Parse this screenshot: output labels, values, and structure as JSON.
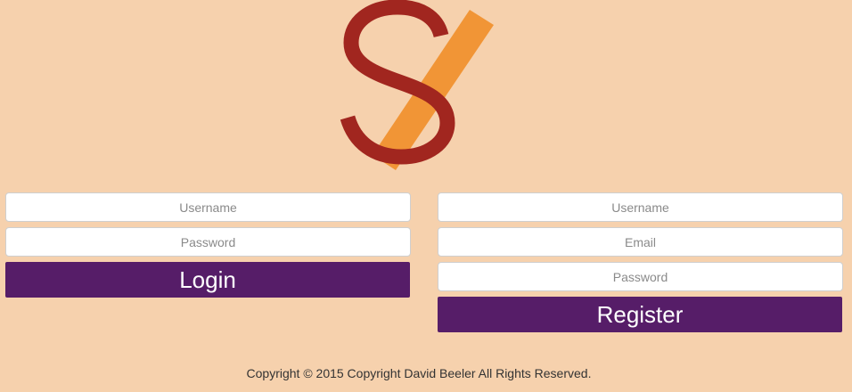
{
  "logo": {
    "letter": "S",
    "letter_color": "#a1261f",
    "slash_color": "#f19536"
  },
  "login": {
    "username_placeholder": "Username",
    "password_placeholder": "Password",
    "button_label": "Login"
  },
  "register": {
    "username_placeholder": "Username",
    "email_placeholder": "Email",
    "password_placeholder": "Password",
    "button_label": "Register"
  },
  "footer": {
    "copyright": "Copyright © 2015 Copyright David Beeler All Rights Reserved."
  },
  "colors": {
    "background": "#f6d1ad",
    "button": "#561d68",
    "button_text": "#ffffff"
  }
}
